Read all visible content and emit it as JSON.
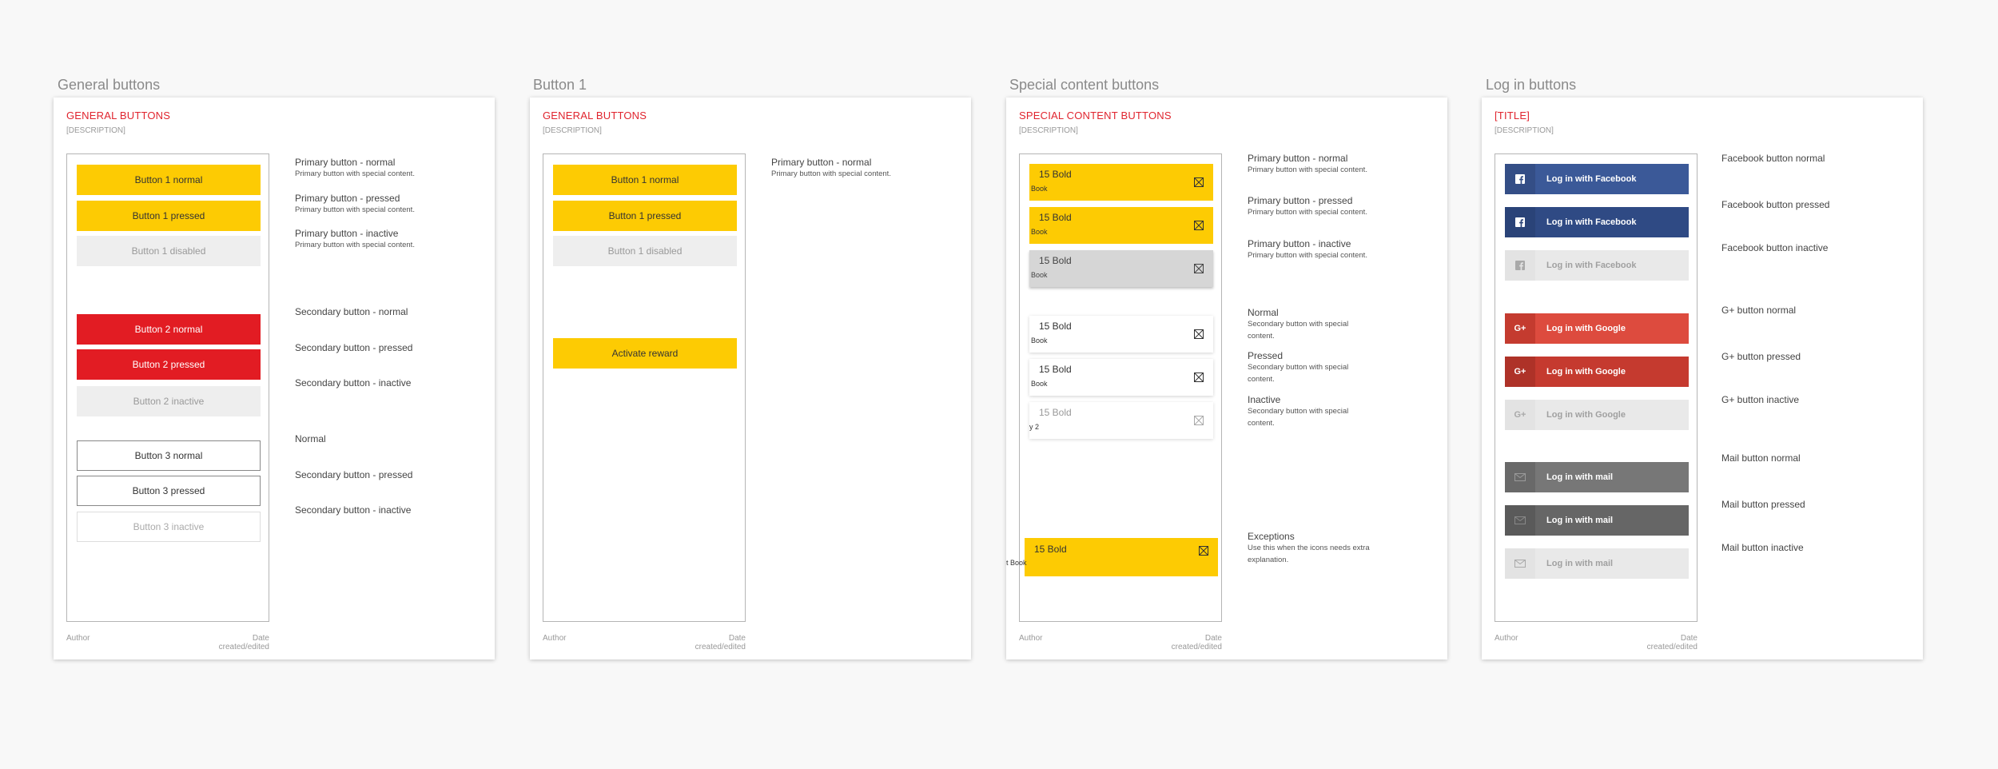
{
  "boards": [
    {
      "title": "General buttons",
      "heading": "GENERAL BUTTONS",
      "description": "[DESCRIPTION]",
      "author": "Author",
      "date": "Date created/edited",
      "buttons": [
        "Button 1 normal",
        "Button 1 pressed",
        "Button 1 disabled",
        "Button 2 normal",
        "Button 2 pressed",
        "Button 2 inactive",
        "Button 3 normal",
        "Button 3 pressed",
        "Button 3 inactive"
      ],
      "labels": [
        {
          "title": "Primary button - normal",
          "sub": "Primary button with special content."
        },
        {
          "title": "Primary button - pressed",
          "sub": "Primary button with special content."
        },
        {
          "title": "Primary button - inactive",
          "sub": "Primary button with special content."
        },
        {
          "title": "Secondary button - normal"
        },
        {
          "title": "Secondary button - pressed"
        },
        {
          "title": "Secondary button - inactive"
        },
        {
          "title": "Normal"
        },
        {
          "title": "Secondary button - pressed"
        },
        {
          "title": "Secondary button - inactive"
        }
      ]
    },
    {
      "title": "Button 1",
      "heading": "GENERAL BUTTONS",
      "description": "[DESCRIPTION]",
      "author": "Author",
      "date": "Date created/edited",
      "buttons": [
        "Button 1 normal",
        "Button 1 pressed",
        "Button 1 disabled",
        "Activate reward"
      ],
      "labels": [
        {
          "title": "Primary button - normal",
          "sub": "Primary button with special content."
        }
      ]
    },
    {
      "title": "Special content buttons",
      "heading": "SPECIAL CONTENT BUTTONS",
      "description": "[DESCRIPTION]",
      "author": "Author",
      "date": "Date created/edited",
      "cards": [
        {
          "title": "15 Bold",
          "sub": "Book"
        },
        {
          "title": "15 Bold",
          "sub": "Book"
        },
        {
          "title": "15 Bold",
          "sub": "Book"
        },
        {
          "title": "15 Bold",
          "sub": "Book"
        },
        {
          "title": "15 Bold",
          "sub": "Book"
        },
        {
          "title": "15 Bold",
          "sub": "y 2"
        },
        {
          "title": "15 Bold",
          "sub": "t Book"
        }
      ],
      "labels": [
        {
          "title": "Primary button - normal",
          "sub": "Primary button with special content."
        },
        {
          "title": "Primary button - pressed",
          "sub": "Primary button with special content."
        },
        {
          "title": "Primary button - inactive",
          "sub": "Primary button with special content."
        },
        {
          "title": "Normal",
          "sub": "Secondary button with special content."
        },
        {
          "title": "Pressed",
          "sub": "Secondary button with special content."
        },
        {
          "title": "Inactive",
          "sub": "Secondary button with special content."
        },
        {
          "title": "Exceptions",
          "sub": "Use this when the icons needs extra explanation."
        }
      ]
    },
    {
      "title": "Log in buttons",
      "heading": "[TITLE]",
      "description": "[DESCRIPTION]",
      "author": "Author",
      "date": "Date created/edited",
      "buttons": [
        {
          "label": "Log in with Facebook",
          "icon": "facebook-icon"
        },
        {
          "label": "Log in with Facebook",
          "icon": "facebook-icon"
        },
        {
          "label": "Log in with Facebook",
          "icon": "facebook-icon"
        },
        {
          "label": "Log in with Google",
          "icon": "google-plus-icon"
        },
        {
          "label": "Log in with Google",
          "icon": "google-plus-icon"
        },
        {
          "label": "Log in with Google",
          "icon": "google-plus-icon"
        },
        {
          "label": "Log in with mail",
          "icon": "mail-icon"
        },
        {
          "label": "Log in with mail",
          "icon": "mail-icon"
        },
        {
          "label": "Log in with mail",
          "icon": "mail-icon"
        }
      ],
      "labels": [
        "Facebook button normal",
        "Facebook button pressed",
        "Facebook button inactive",
        "G+ button normal",
        "G+ button pressed",
        "G+ button inactive",
        "Mail button normal",
        "Mail button pressed",
        "Mail button inactive"
      ]
    }
  ],
  "colors": {
    "accent": "#e0242e",
    "primary_yellow": "#fdcb03",
    "secondary_red": "#e21c23",
    "facebook": "#3b5998",
    "google": "#dd4b3e",
    "mail": "#777777"
  }
}
